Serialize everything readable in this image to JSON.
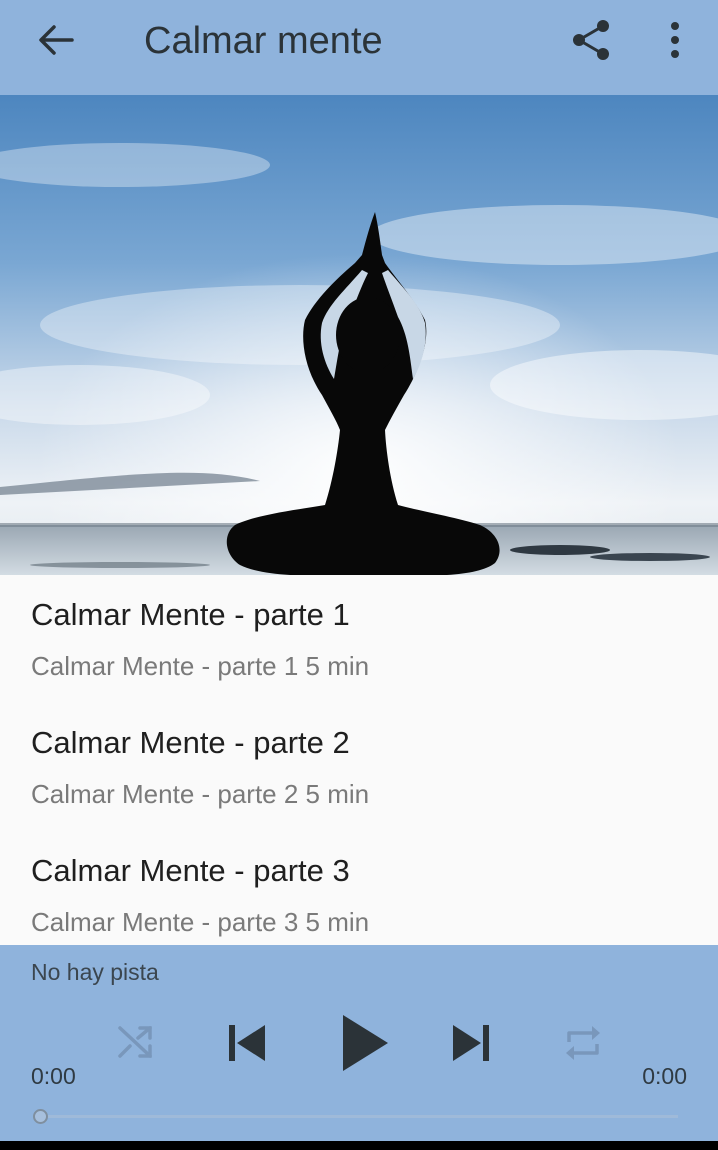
{
  "appbar": {
    "title": "Calmar mente",
    "back_icon": "arrow-back-icon",
    "share_icon": "share-icon",
    "more_icon": "more-vert-icon"
  },
  "colors": {
    "appbar": "#8fb3dc",
    "player": "#8fb3dc",
    "background": "#fafafa"
  },
  "tracks": [
    {
      "title": "Calmar Mente - parte 1",
      "subtitle": "Calmar Mente - parte 1 5 min"
    },
    {
      "title": "Calmar Mente - parte 2",
      "subtitle": "Calmar Mente - parte 2 5 min"
    },
    {
      "title": "Calmar Mente - parte 3",
      "subtitle": "Calmar Mente - parte 3 5 min"
    }
  ],
  "player": {
    "track_label": "No hay pista",
    "elapsed": "0:00",
    "duration": "0:00",
    "progress": 0,
    "controls": [
      "shuffle-icon",
      "skip-previous-icon",
      "play-icon",
      "skip-next-icon",
      "repeat-icon"
    ]
  }
}
